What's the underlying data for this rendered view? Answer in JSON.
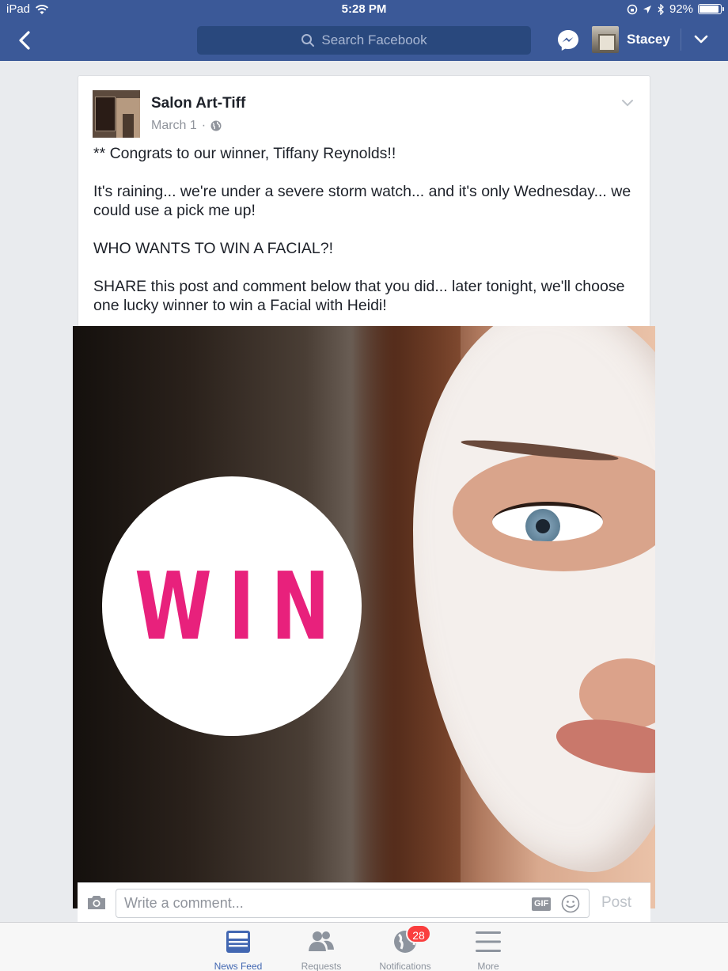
{
  "status_bar": {
    "device": "iPad",
    "time": "5:28 PM",
    "battery": "92%",
    "battery_level": 0.92
  },
  "nav": {
    "search_placeholder": "Search Facebook",
    "user_name": "Stacey"
  },
  "post": {
    "page_name": "Salon Art-Tiff",
    "date": "March 1",
    "separator": "·",
    "paragraphs": [
      "** Congrats to our winner, Tiffany Reynolds!!",
      "It's raining... we're under a severe storm watch... and it's only Wednesday... we could use a pick me up!",
      "WHO WANTS TO WIN A FACIAL?!",
      "SHARE this post and comment below that you did... later tonight, we'll choose one lucky winner to win a Facial with Heidi!"
    ],
    "image_text": "WIN"
  },
  "comment": {
    "placeholder": "Write a comment...",
    "gif_label": "GIF",
    "post_label": "Post"
  },
  "tabs": [
    {
      "label": "News Feed",
      "icon": "news-feed-icon",
      "active": true
    },
    {
      "label": "Requests",
      "icon": "friends-icon",
      "active": false
    },
    {
      "label": "Notifications",
      "icon": "globe-icon",
      "active": false,
      "badge": "28"
    },
    {
      "label": "More",
      "icon": "menu-icon",
      "active": false
    }
  ],
  "colors": {
    "facebook_blue": "#3b5998",
    "search_bg": "#29487d",
    "win_pink": "#e8217c",
    "badge_red": "#fa3e3e",
    "active_tab": "#4267b2"
  }
}
